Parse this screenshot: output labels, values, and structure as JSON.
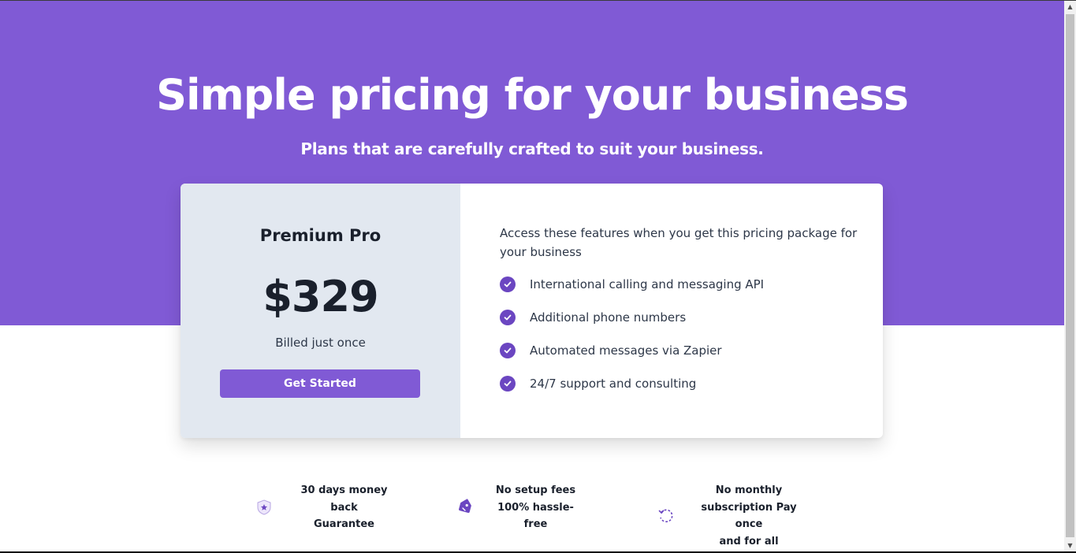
{
  "hero": {
    "title": "Simple pricing for your business",
    "subtitle": "Plans that are carefully crafted to suit your business."
  },
  "plan": {
    "name": "Premium Pro",
    "price": "$329",
    "billing": "Billed just once",
    "cta_label": "Get Started"
  },
  "features": {
    "intro": "Access these features when you get this pricing package for your business",
    "items": [
      {
        "label": "International calling and messaging API",
        "icon": "check-circle-icon"
      },
      {
        "label": "Additional phone numbers",
        "icon": "check-circle-icon"
      },
      {
        "label": "Automated messages via Zapier",
        "icon": "check-circle-icon"
      },
      {
        "label": "24/7 support and consulting",
        "icon": "check-circle-icon"
      }
    ]
  },
  "guarantees": [
    {
      "icon": "shield-star-icon",
      "lines": [
        "30 days money",
        "back",
        "Guarantee"
      ]
    },
    {
      "icon": "price-tag-icon",
      "lines": [
        "No setup fees",
        "100% hassle-",
        "free"
      ]
    },
    {
      "icon": "refresh-icon",
      "lines": [
        "No monthly",
        "subscription Pay once",
        "and for all"
      ]
    }
  ],
  "colors": {
    "brand_purple": "#805ad5",
    "check_purple": "#6b46c1",
    "plan_pane_bg": "#e2e8f0",
    "text_dark": "#1a202c"
  }
}
